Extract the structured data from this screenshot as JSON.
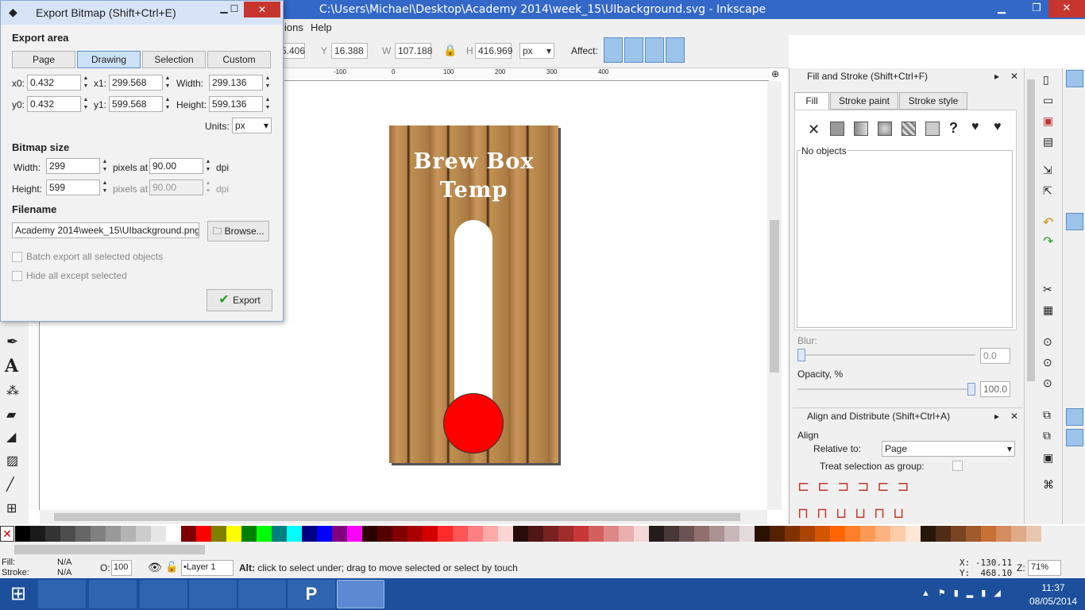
{
  "window": {
    "title": "C:\\Users\\Michael\\Desktop\\Academy 2014\\week_15\\UIbackground.svg - Inkscape",
    "minimize": "▁",
    "maximize": "❐",
    "close": "✕"
  },
  "menu": {
    "items": [
      "ions",
      "Help"
    ]
  },
  "toolbar": {
    "x_value": "5.406",
    "y_label": "Y",
    "y_value": "16.388",
    "w_label": "W",
    "w_value": "107.188",
    "h_label": "H",
    "h_value": "416.969",
    "unit": "px",
    "affect_label": "Affect:"
  },
  "export_dialog": {
    "title": "Export Bitmap (Shift+Ctrl+E)",
    "export_area_label": "Export area",
    "tabs": [
      "Page",
      "Drawing",
      "Selection",
      "Custom"
    ],
    "active_tab": "Drawing",
    "x0_label": "x0:",
    "x0": "0.432",
    "x1_label": "x1:",
    "x1": "299.568",
    "width_label": "Width:",
    "width": "299.136",
    "y0_label": "y0:",
    "y0": "0.432",
    "y1_label": "y1:",
    "y1": "599.568",
    "height_label": "Height:",
    "height": "599.136",
    "units_label": "Units:",
    "units": "px",
    "bitmap_size_label": "Bitmap size",
    "bm_width_label": "Width:",
    "bm_width": "299",
    "pixels_at": "pixels at",
    "dpi_x": "90.00",
    "dpi": "dpi",
    "bm_height_label": "Height:",
    "bm_height": "599",
    "dpi_y": "90.00",
    "filename_label": "Filename",
    "filename": "Academy 2014\\week_15\\UIbackground.png",
    "browse": "Browse...",
    "batch_label": "Batch export all selected objects",
    "hide_label": "Hide all except selected",
    "export_button": "Export"
  },
  "canvas": {
    "sign_line1": "Brew Box",
    "sign_line2": "Temp",
    "ruler_labels": [
      "-100",
      "0",
      "100",
      "200",
      "300",
      "400"
    ]
  },
  "fill_stroke": {
    "title": "Fill and Stroke (Shift+Ctrl+F)",
    "tab_fill": "Fill",
    "tab_stroke_paint": "Stroke paint",
    "tab_stroke_style": "Stroke style",
    "no_objects": "No objects",
    "blur_label": "Blur:",
    "blur_value": "0.0",
    "opacity_label": "Opacity, %",
    "opacity_value": "100.0",
    "opacity_level": 1.0
  },
  "align": {
    "title": "Align and Distribute (Shift+Ctrl+A)",
    "align_label": "Align",
    "relative_label": "Relative to:",
    "relative_value": "Page",
    "group_label": "Treat selection as group:"
  },
  "status": {
    "fill_label": "Fill:",
    "fill_value": "N/A",
    "stroke_label": "Stroke:",
    "stroke_value": "N/A",
    "opacity_label": "O:",
    "opacity_value": "100",
    "layer": "•Layer 1",
    "message_bold": "Alt:",
    "message": " click to select under; drag to move selected or select by touch",
    "x_coord": "X: -130.11",
    "y_coord": "Y:  468.10",
    "zoom_label": "Z:",
    "zoom": "71%"
  },
  "taskbar": {
    "time": "11:37",
    "date": "08/05/2014"
  },
  "palette": [
    "#000000",
    "#1a1a1a",
    "#333333",
    "#4d4d4d",
    "#666666",
    "#808080",
    "#999999",
    "#b3b3b3",
    "#cccccc",
    "#e6e6e6",
    "#ffffff",
    "#800000",
    "#ff0000",
    "#808000",
    "#ffff00",
    "#008000",
    "#00ff00",
    "#008080",
    "#00ffff",
    "#000080",
    "#0000ff",
    "#800080",
    "#ff00ff",
    "#2b0000",
    "#550000",
    "#800000",
    "#aa0000",
    "#d40000",
    "#ff2a2a",
    "#ff5555",
    "#ff8080",
    "#ffaaaa",
    "#ffd5d5",
    "#280b0b",
    "#501616",
    "#782121",
    "#a02c2c",
    "#c83737",
    "#d35f5f",
    "#de8787",
    "#e9afaf",
    "#f4d7d7",
    "#241c1c",
    "#483737",
    "#6c5353",
    "#916f6f",
    "#ac9393",
    "#c8b7b7",
    "#e3dbdb",
    "#2b1100",
    "#552200",
    "#803300",
    "#aa4400",
    "#d45500",
    "#ff6600",
    "#ff7f2a",
    "#ff9955",
    "#ffb380",
    "#ffccaa",
    "#ffe6d5",
    "#28170b",
    "#502d16",
    "#784421",
    "#a05a2c",
    "#c87137",
    "#d38d5f",
    "#deaa87",
    "#e9c6af"
  ]
}
